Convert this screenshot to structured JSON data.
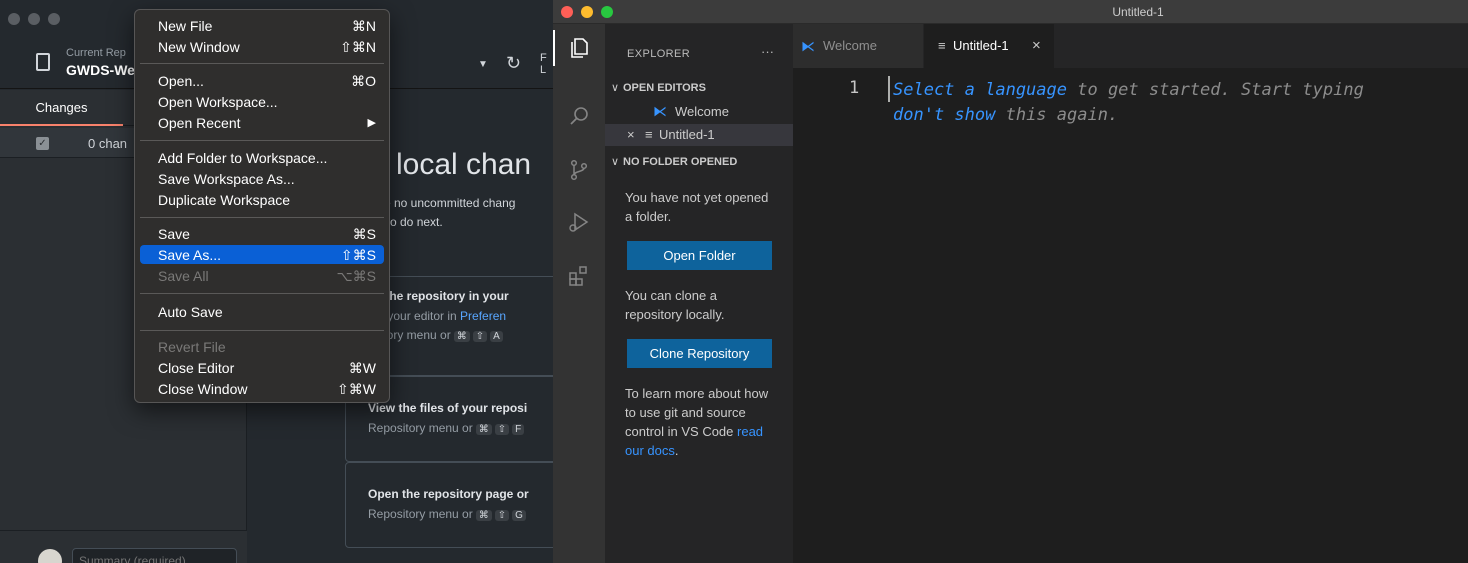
{
  "github_desktop": {
    "current_repository_label": "Current Rep",
    "repository_name": "GWDS-We",
    "fetch_label": "F",
    "fetch_sub": "L",
    "tabs": {
      "changes": "Changes"
    },
    "changes_count": "0 chan",
    "main_title": "local chan",
    "main_sub1": "re no uncommitted chang",
    "main_sub2": "t to do next.",
    "suggestions": [
      {
        "title": "en the repository in your",
        "desc": "ect your editor in ",
        "desc_link": "Preferen",
        "desc2": "ository menu or",
        "keys": [
          "⌘",
          "⇧",
          "A"
        ]
      },
      {
        "title": "View the files of your reposi",
        "desc": "Repository menu or",
        "keys": [
          "⌘",
          "⇧",
          "F"
        ]
      },
      {
        "title": "Open the repository page or",
        "desc": "Repository menu or",
        "keys": [
          "⌘",
          "⇧",
          "G"
        ]
      }
    ],
    "summary_placeholder": "Summary (required)"
  },
  "file_menu": {
    "items": [
      {
        "label": "New File",
        "shortcut": "⌘N"
      },
      {
        "label": "New Window",
        "shortcut": "⇧⌘N"
      },
      {
        "label": "Open...",
        "shortcut": "⌘O"
      },
      {
        "label": "Open Workspace...",
        "shortcut": ""
      },
      {
        "label": "Open Recent",
        "shortcut": "▶"
      },
      {
        "label": "Add Folder to Workspace...",
        "shortcut": ""
      },
      {
        "label": "Save Workspace As...",
        "shortcut": ""
      },
      {
        "label": "Duplicate Workspace",
        "shortcut": ""
      },
      {
        "label": "Save",
        "shortcut": "⌘S"
      },
      {
        "label": "Save As...",
        "shortcut": "⇧⌘S"
      },
      {
        "label": "Save All",
        "shortcut": "⌥⌘S"
      },
      {
        "label": "Auto Save",
        "shortcut": ""
      },
      {
        "label": "Revert File",
        "shortcut": ""
      },
      {
        "label": "Close Editor",
        "shortcut": "⌘W"
      },
      {
        "label": "Close Window",
        "shortcut": "⇧⌘W"
      }
    ]
  },
  "vscode": {
    "window_title": "Untitled-1",
    "explorer_title": "EXPLORER",
    "more_actions": "···",
    "open_editors_header": "OPEN EDITORS",
    "open_editors": [
      {
        "label": "Welcome"
      },
      {
        "label": "Untitled-1"
      }
    ],
    "no_folder_header": "NO FOLDER OPENED",
    "no_folder_text": "You have not yet opened a folder.",
    "open_folder_button": "Open Folder",
    "clone_text": "You can clone a repository locally.",
    "clone_button": "Clone Repository",
    "learn_text": "To learn more about how to use git and source control in VS Code ",
    "learn_link": "read our docs",
    "learn_end": ".",
    "tabs": [
      {
        "label": "Welcome"
      },
      {
        "label": "Untitled-1",
        "close": "×"
      }
    ],
    "editor": {
      "line_number": "1",
      "hint": {
        "select_language": "Select a language",
        "rest1": " to get started. Start typing",
        "dont_show": "don't show",
        "rest2": " this again."
      }
    },
    "colors": {
      "accent_blue": "#0e639c",
      "link_blue": "#3794ff",
      "menu_highlight": "#0a60d6"
    }
  }
}
